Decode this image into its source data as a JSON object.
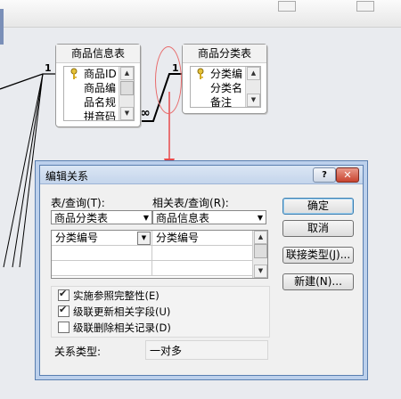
{
  "background_tables": [
    {
      "title": "商品信息表",
      "fields": [
        {
          "name": "商品ID",
          "key": true
        },
        {
          "name": "商品编",
          "key": false
        },
        {
          "name": "品名规",
          "key": false
        },
        {
          "name": "拼音码",
          "key": false
        }
      ]
    },
    {
      "title": "商品分类表",
      "fields": [
        {
          "name": "分类编",
          "key": true
        },
        {
          "name": "分类名",
          "key": false
        },
        {
          "name": "备注",
          "key": false
        }
      ]
    }
  ],
  "relationship_markers": {
    "one_left": "1",
    "one_right": "1",
    "many": "∞"
  },
  "dialog": {
    "title": "编辑关系",
    "help_label": "?",
    "close_label": "✕",
    "table_query_label": "表/查询(T):",
    "related_table_query_label": "相关表/查询(R):",
    "table_query_value": "商品分类表",
    "related_table_query_value": "商品信息表",
    "field_grid": [
      [
        "分类编号",
        "分类编号"
      ],
      [
        "",
        ""
      ],
      [
        "",
        ""
      ]
    ],
    "buttons": {
      "ok": "确定",
      "cancel": "取消",
      "join_type": "联接类型(J)...",
      "create_new": "新建(N)..."
    },
    "options": [
      {
        "label": "实施参照完整性(E)",
        "checked": true
      },
      {
        "label": "级联更新相关字段(U)",
        "checked": true
      },
      {
        "label": "级联删除相关记录(D)",
        "checked": false
      }
    ],
    "relationship_type_label": "关系类型:",
    "relationship_type_value": "一对多"
  },
  "colors": {
    "accent": "#3c7fb1",
    "annotation_red": "#e84a4a",
    "close_button": "#c8432f"
  }
}
